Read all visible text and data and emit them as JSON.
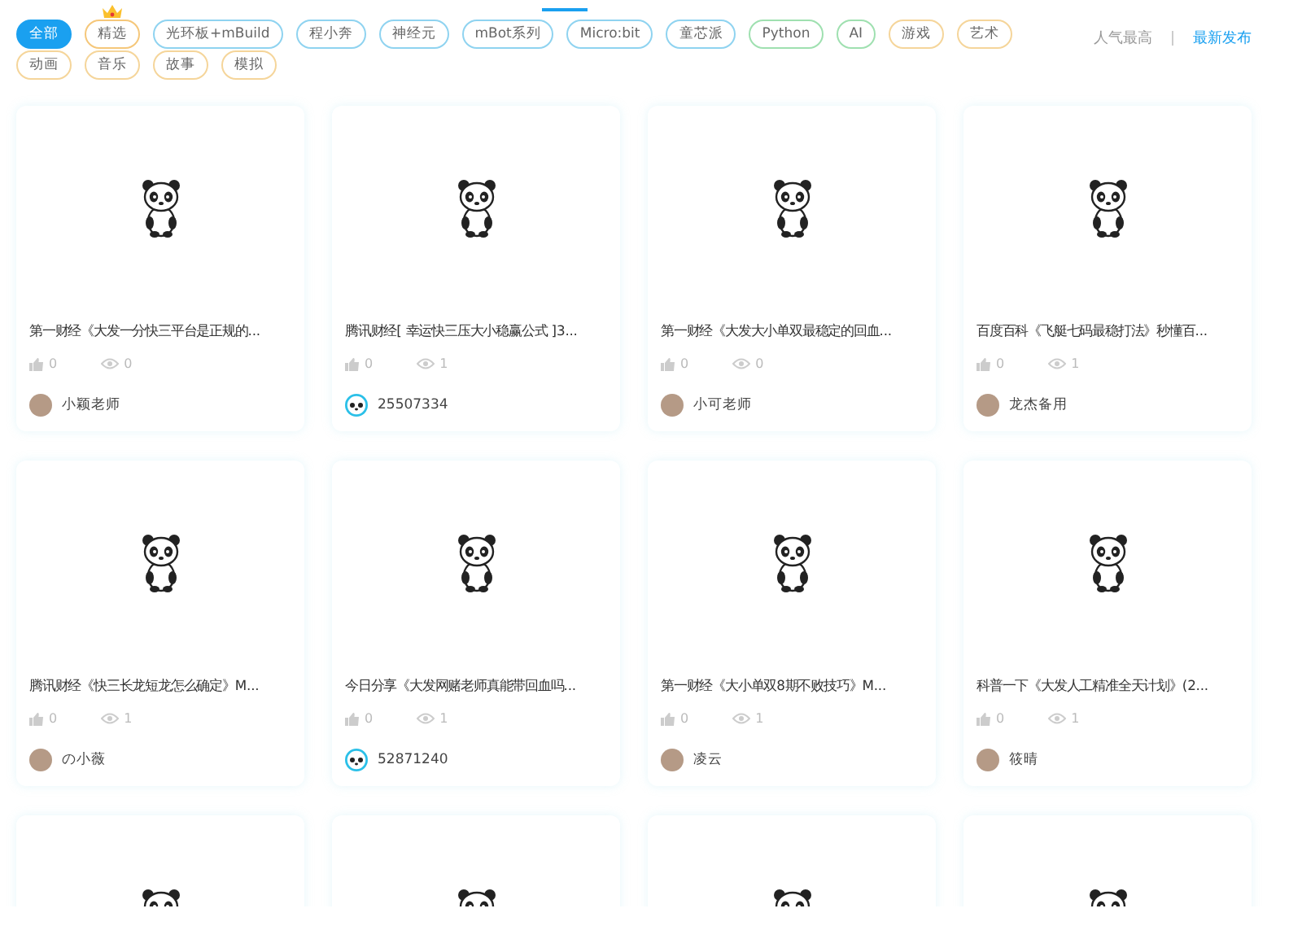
{
  "tags": [
    {
      "label": "全部",
      "selected": true,
      "color": "#1aa0f0",
      "badge": false
    },
    {
      "label": "精选",
      "selected": false,
      "color": "#f5c77a",
      "badge": true
    },
    {
      "label": "光环板+mBuild",
      "selected": false,
      "color": "#8fd3f0",
      "badge": false
    },
    {
      "label": "程小奔",
      "selected": false,
      "color": "#8fd3f0",
      "badge": false
    },
    {
      "label": "神经元",
      "selected": false,
      "color": "#8fd3f0",
      "badge": false
    },
    {
      "label": "mBot系列",
      "selected": false,
      "color": "#8fd3f0",
      "badge": false
    },
    {
      "label": "Micro:bit",
      "selected": false,
      "color": "#8fd3f0",
      "badge": false
    },
    {
      "label": "童芯派",
      "selected": false,
      "color": "#8fd3f0",
      "badge": false
    },
    {
      "label": "Python",
      "selected": false,
      "color": "#9fe0b0",
      "badge": false
    },
    {
      "label": "AI",
      "selected": false,
      "color": "#9fe0b0",
      "badge": false
    },
    {
      "label": "游戏",
      "selected": false,
      "color": "#f5d59a",
      "badge": false
    },
    {
      "label": "艺术",
      "selected": false,
      "color": "#f5d59a",
      "badge": false
    },
    {
      "label": "动画",
      "selected": false,
      "color": "#f5d59a",
      "badge": false
    },
    {
      "label": "音乐",
      "selected": false,
      "color": "#f5d59a",
      "badge": false
    },
    {
      "label": "故事",
      "selected": false,
      "color": "#f5d59a",
      "badge": false
    },
    {
      "label": "模拟",
      "selected": false,
      "color": "#f5d59a",
      "badge": false
    }
  ],
  "sort": [
    {
      "label": "人气最高",
      "selected": false
    },
    {
      "label": "最新发布",
      "selected": true
    }
  ],
  "cards": [
    {
      "title": "第一财经《大发一分快三平台是正规的...",
      "likes": "0",
      "views": "0",
      "author": "小颖老师",
      "avatar": {
        "kind": "photo"
      },
      "kind": "project"
    },
    {
      "title": "腾讯财经[ 幸运快三压大小稳赢公式 ]3...",
      "likes": "0",
      "views": "1",
      "author": "25507334",
      "avatar": {
        "kind": "panda"
      },
      "kind": "project"
    },
    {
      "title": "第一财经《大发大小单双最稳定的回血...",
      "likes": "0",
      "views": "0",
      "author": "小可老师",
      "avatar": {
        "kind": "photo"
      },
      "kind": "project"
    },
    {
      "title": "百度百科《飞艇七码最稳打法》秒懂百...",
      "likes": "0",
      "views": "1",
      "author": "龙杰备用",
      "avatar": {
        "kind": "photo"
      },
      "kind": "project"
    },
    {
      "title": "腾讯财经《快三长龙短龙怎么确定》M...",
      "likes": "0",
      "views": "1",
      "author": "の小薇",
      "avatar": {
        "kind": "photo"
      },
      "kind": "project"
    },
    {
      "title": "今日分享《大发网赌老师真能带回血吗...",
      "likes": "0",
      "views": "1",
      "author": "52871240",
      "avatar": {
        "kind": "panda"
      },
      "kind": "project"
    },
    {
      "title": "第一财经《大小单双8期不败技巧》M...",
      "likes": "0",
      "views": "1",
      "author": "凌云",
      "avatar": {
        "kind": "photo"
      },
      "kind": "project"
    },
    {
      "title": "科普一下《大发人工精准全天计划》(2...",
      "likes": "0",
      "views": "1",
      "author": "筱晴",
      "avatar": {
        "kind": "photo"
      },
      "kind": "project"
    },
    {
      "kind": "image_only"
    },
    {
      "kind": "image_only"
    },
    {
      "kind": "image_only"
    },
    {
      "kind": "image_only"
    }
  ]
}
